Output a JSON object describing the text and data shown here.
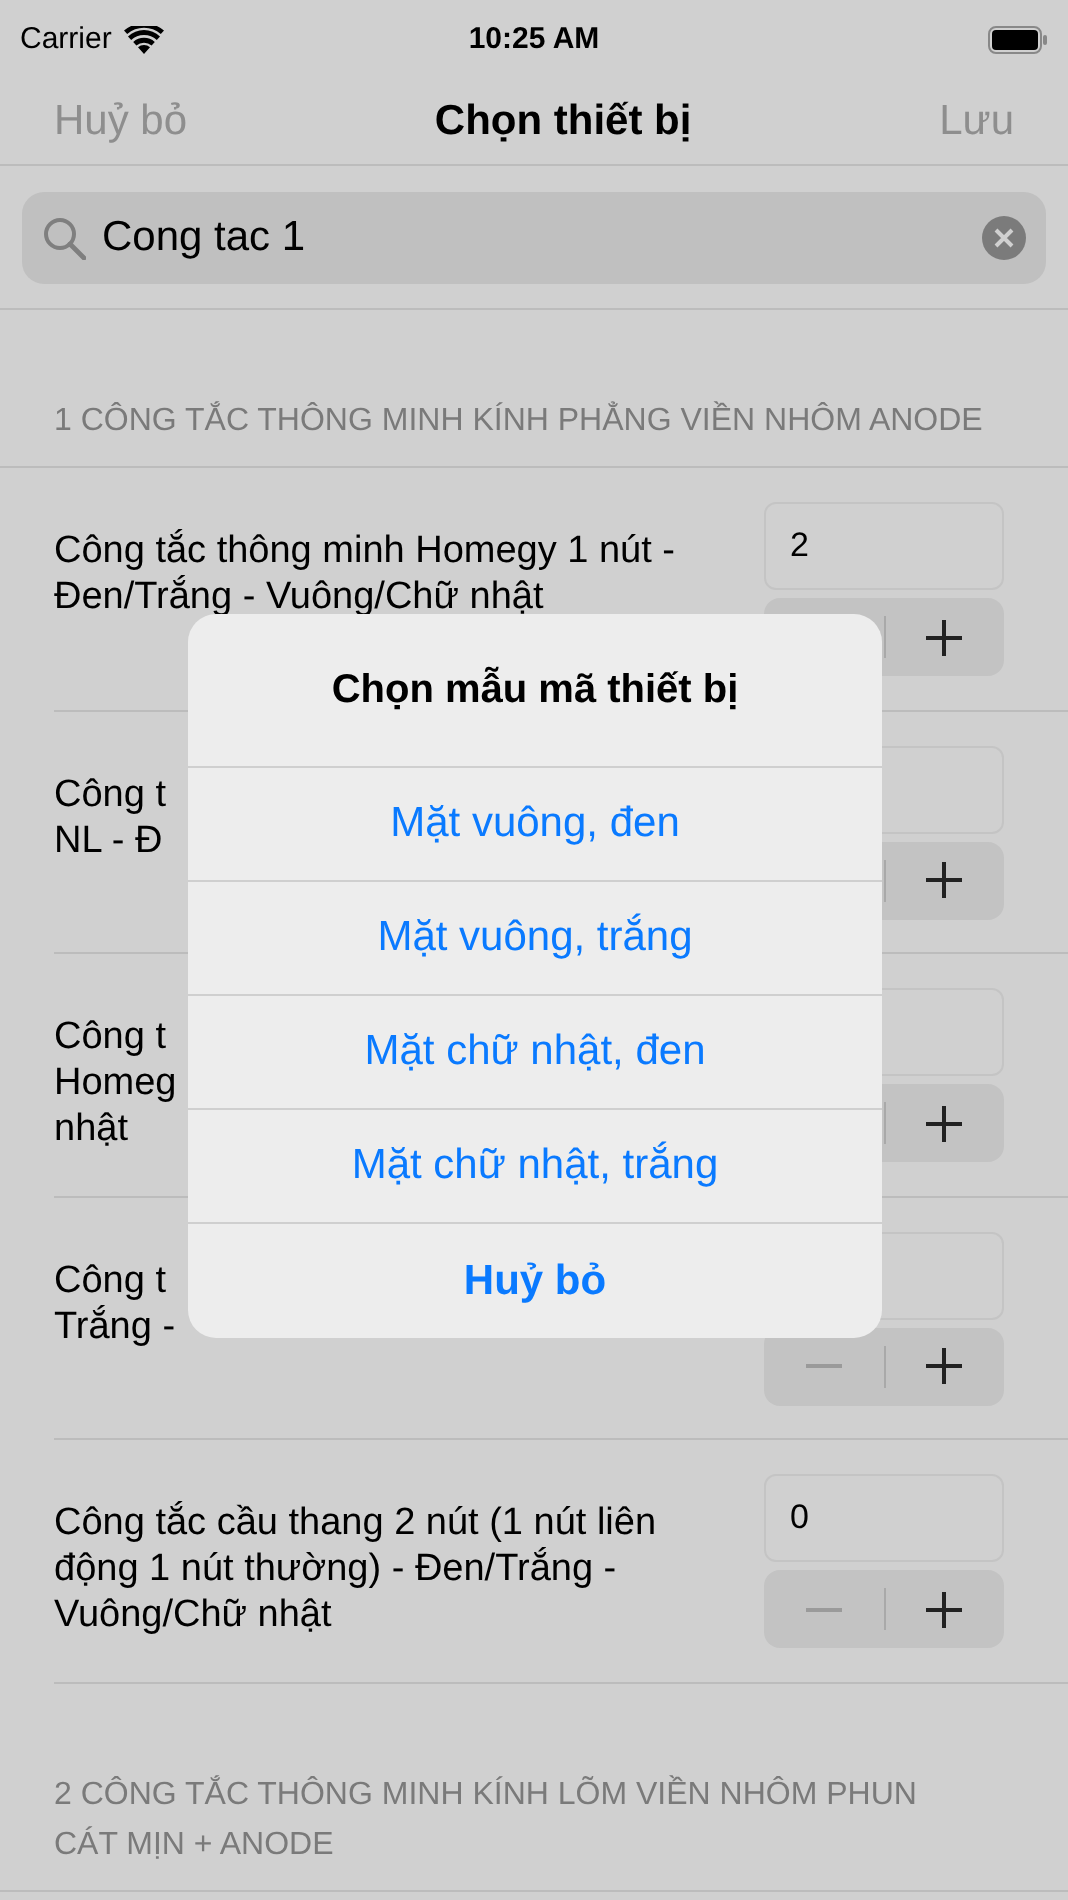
{
  "status_bar": {
    "carrier": "Carrier",
    "time": "10:25 AM"
  },
  "nav": {
    "left": "Huỷ bỏ",
    "title": "Chọn thiết bị",
    "right": "Lưu"
  },
  "search": {
    "value": "Cong tac 1"
  },
  "sections": [
    {
      "header": [
        "1 CÔNG TẮC THÔNG MINH KÍNH PHẲNG VIỀN NHÔM ANODE"
      ],
      "rows": [
        {
          "lines": [
            "Công tắc thông minh Homegy 1 nút -",
            "Đen/Trắng - Vuông/Chữ nhật"
          ],
          "value": "2"
        },
        {
          "lines": [
            "Công t",
            "NL - Đ"
          ]
        },
        {
          "lines": [
            "Công t",
            "Homeg",
            "nhật"
          ]
        },
        {
          "lines": [
            "Công t",
            "Trắng -"
          ]
        },
        {
          "lines": [
            "Công tắc cầu thang 2 nút (1 nút liên",
            "động 1 nút thường) - Đen/Trắng -",
            "Vuông/Chữ nhật"
          ],
          "value": "0"
        }
      ]
    },
    {
      "header": [
        "2 CÔNG TẮC THÔNG MINH KÍNH LÕM VIỀN NHÔM PHUN",
        "CÁT MỊN + ANODE"
      ]
    }
  ],
  "alert": {
    "title": "Chọn mẫu mã thiết bị",
    "actions": [
      {
        "label": "Mặt vuông, đen",
        "kind": "default"
      },
      {
        "label": "Mặt vuông, trắng",
        "kind": "default"
      },
      {
        "label": "Mặt chữ nhật, đen",
        "kind": "default"
      },
      {
        "label": "Mặt chữ nhật, trắng",
        "kind": "default"
      },
      {
        "label": "Huỷ bỏ",
        "kind": "cancel"
      }
    ]
  }
}
